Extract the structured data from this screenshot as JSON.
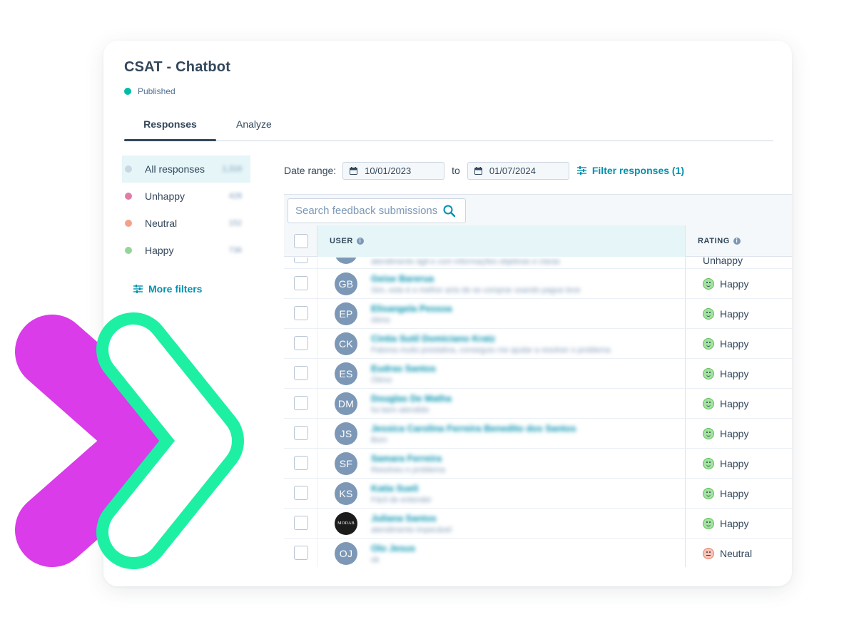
{
  "page": {
    "title": "CSAT - Chatbot",
    "status": "Published",
    "status_color": "#00bda5"
  },
  "tabs": [
    {
      "label": "Responses",
      "active": true
    },
    {
      "label": "Analyze",
      "active": false
    }
  ],
  "filters": {
    "items": [
      {
        "label": "All responses",
        "count": "1,316",
        "color": "#cbd6e2",
        "active": true
      },
      {
        "label": "Unhappy",
        "count": "428",
        "color": "#e07da6",
        "active": false
      },
      {
        "label": "Neutral",
        "count": "152",
        "color": "#f5a08c",
        "active": false
      },
      {
        "label": "Happy",
        "count": "736",
        "color": "#97d49a",
        "active": false
      }
    ],
    "more_label": "More filters"
  },
  "date_range": {
    "label": "Date range:",
    "from": "10/01/2023",
    "to_label": "to",
    "to": "01/07/2024",
    "filter_link": "Filter responses (1)"
  },
  "search": {
    "placeholder": "Search feedback submissions"
  },
  "table": {
    "columns": {
      "user": "USER",
      "rating": "RATING"
    },
    "partial_row": {
      "comment": "atendimento ágil e com informações objetivas e claras",
      "rating": "Unhappy"
    },
    "rows": [
      {
        "initials": "GB",
        "name": "Geise Barerua",
        "comment": "Sim, este é o melhor anis de se comprar usando pague leve",
        "rating": "Happy",
        "sentiment": "happy"
      },
      {
        "initials": "EP",
        "name": "Elisangela Pessoa",
        "comment": "ótimo",
        "rating": "Happy",
        "sentiment": "happy"
      },
      {
        "initials": "CK",
        "name": "Cintia Sutil Domiciano Kratz",
        "comment": "Paloma muito prestativa, conseguiu me ajudar a resolver o problema",
        "rating": "Happy",
        "sentiment": "happy"
      },
      {
        "initials": "ES",
        "name": "Eudras Santos",
        "comment": "Ótimo",
        "rating": "Happy",
        "sentiment": "happy"
      },
      {
        "initials": "DM",
        "name": "Douglas De Matha",
        "comment": "fui bem atendido",
        "rating": "Happy",
        "sentiment": "happy"
      },
      {
        "initials": "JS",
        "name": "Jessica Carolina Ferreira Benedito dos Santos",
        "comment": "Bom",
        "rating": "Happy",
        "sentiment": "happy"
      },
      {
        "initials": "SF",
        "name": "Samara Ferreira",
        "comment": "Resolveu o problema",
        "rating": "Happy",
        "sentiment": "happy"
      },
      {
        "initials": "KS",
        "name": "Katia Sueli",
        "comment": "Fácil de entender",
        "rating": "Happy",
        "sentiment": "happy"
      },
      {
        "initials": "MODAB",
        "name": "Juliana Santos",
        "comment": "atendimento impecável",
        "rating": "Happy",
        "sentiment": "happy",
        "logo": true
      },
      {
        "initials": "OJ",
        "name": "Olo Jesus",
        "comment": "ok",
        "rating": "Neutral",
        "sentiment": "neutral"
      }
    ]
  },
  "colors": {
    "accent": "#0091ae",
    "text": "#33475b",
    "deco_magenta": "#d93ce8",
    "deco_green": "#1ef0a3"
  }
}
